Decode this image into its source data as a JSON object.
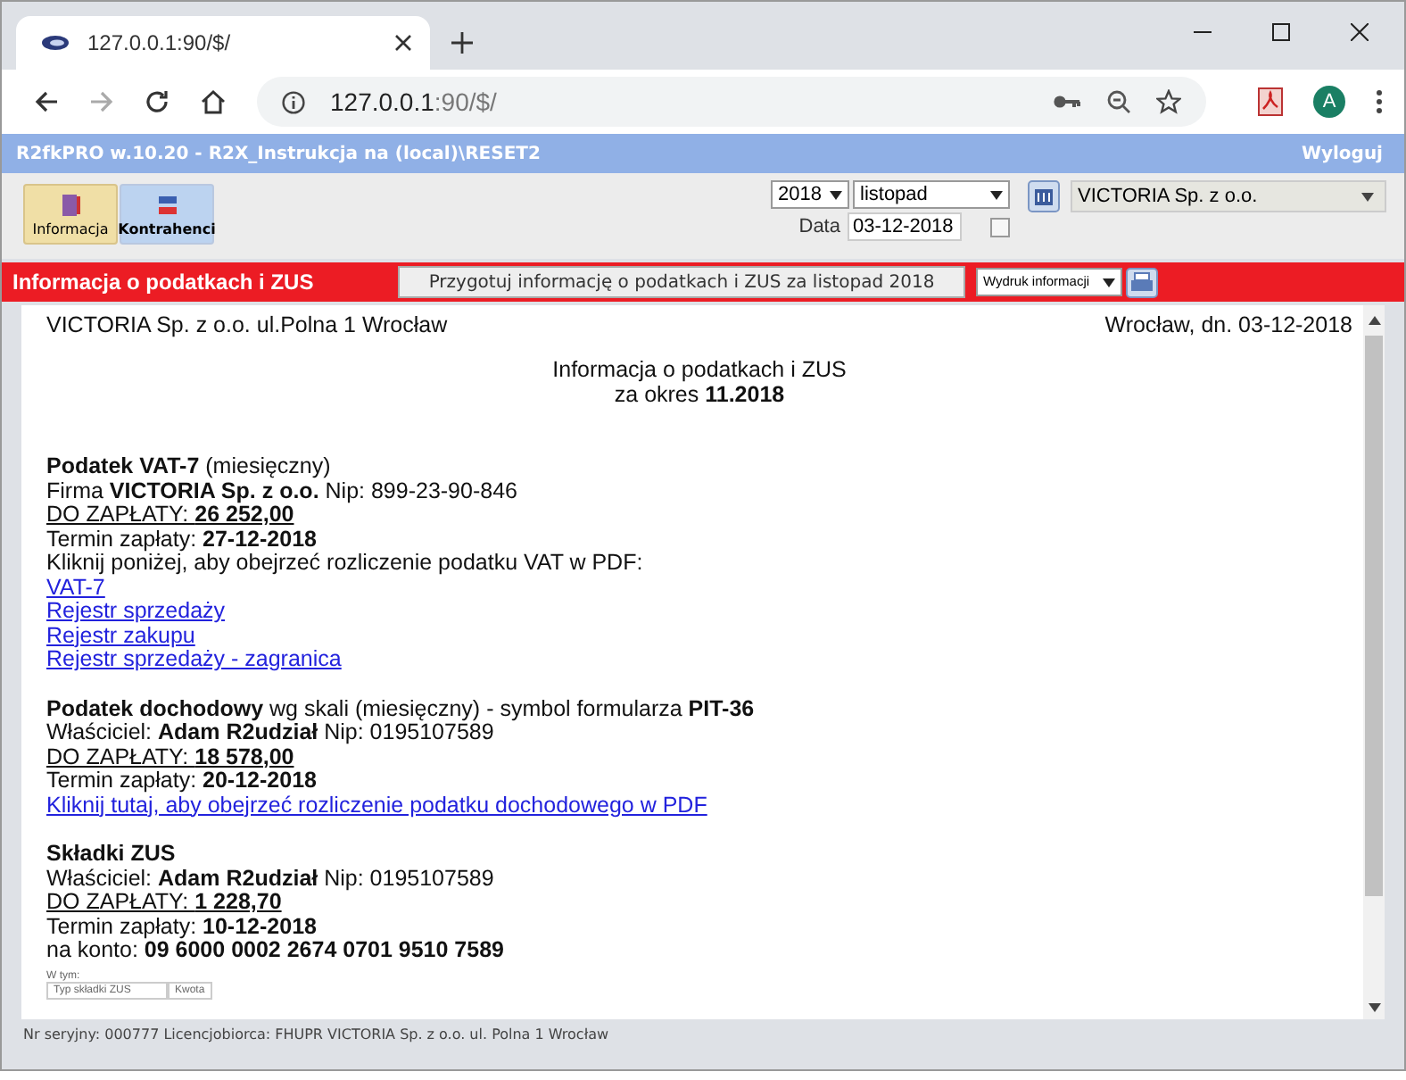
{
  "browser": {
    "tab_title": "127.0.0.1:90/$/",
    "url_host": "127.0.0.1",
    "url_rest": ":90/$/",
    "avatar": "A"
  },
  "app": {
    "title": "R2fkPRO w.10.20 - R2X_Instrukcja na (local)\\RESET2",
    "logout": "Wyloguj"
  },
  "toolbar": {
    "buttons": [
      {
        "label": "Informacja",
        "selected": true
      },
      {
        "label": "Kontrahenci",
        "selected": false
      }
    ],
    "year": "2018",
    "month": "listopad",
    "date_label": "Data",
    "date": "03-12-2018",
    "date_checked": false,
    "company": "VICTORIA Sp. z o.o."
  },
  "section_bar": {
    "title": "Informacja o podatkach i ZUS",
    "prepare_button": "Przygotuj informację o podatkach i ZUS za listopad 2018",
    "print_select": "Wydruk informacji"
  },
  "document": {
    "header_left": "VICTORIA Sp. z o.o. ul.Polna 1 Wrocław",
    "header_right": "Wrocław, dn. 03-12-2018",
    "title": "Informacja o podatkach i ZUS",
    "period": "za okres **11.2018**",
    "sections": [
      {
        "lines": [
          {
            "kind": "text",
            "text": "**Podatek VAT-7** (miesięczny)"
          },
          {
            "kind": "text",
            "text": "Firma **VICTORIA Sp. z o.o.** Nip: 899-23-90-846"
          },
          {
            "kind": "due",
            "text": "DO ZAPŁATY: **26 252,00**"
          },
          {
            "kind": "text",
            "text": "Termin zapłaty: **27-12-2018**"
          },
          {
            "kind": "text",
            "text": "Kliknij poniżej, aby obejrzeć rozliczenie podatku VAT w PDF:"
          },
          {
            "kind": "link",
            "text": "VAT-7"
          },
          {
            "kind": "link",
            "text": "Rejestr sprzedaży"
          },
          {
            "kind": "link",
            "text": "Rejestr zakupu"
          },
          {
            "kind": "link",
            "text": "Rejestr sprzedaży - zagranica"
          }
        ]
      },
      {
        "lines": [
          {
            "kind": "text",
            "text": "**Podatek dochodowy** wg skali (miesięczny) - symbol formularza **PIT-36**"
          },
          {
            "kind": "text",
            "text": "Właściciel: **Adam R2udział** Nip: 0195107589"
          },
          {
            "kind": "due",
            "text": "DO ZAPŁATY: **18 578,00**"
          },
          {
            "kind": "text",
            "text": "Termin zapłaty: **20-12-2018**"
          },
          {
            "kind": "link",
            "text": "Kliknij tutaj, aby obejrzeć rozliczenie podatku dochodowego w PDF"
          }
        ]
      },
      {
        "lines": [
          {
            "kind": "text",
            "text": "**Składki ZUS**"
          },
          {
            "kind": "text",
            "text": "Właściciel: **Adam R2udział** Nip: 0195107589"
          },
          {
            "kind": "due",
            "text": "DO ZAPŁATY: **1 228,70**"
          },
          {
            "kind": "text",
            "text": "Termin zapłaty: **10-12-2018**"
          },
          {
            "kind": "text",
            "text": "na konto: **09 6000 0002 2674 0701 9510 7589**"
          }
        ]
      }
    ],
    "table": {
      "caption": "W tym:",
      "columns": [
        "Typ składki ZUS",
        "Kwota"
      ]
    }
  },
  "footer": "Nr seryjny: 000777 Licencjobiorca: FHUPR VICTORIA Sp. z o.o. ul. Polna 1 Wrocław"
}
